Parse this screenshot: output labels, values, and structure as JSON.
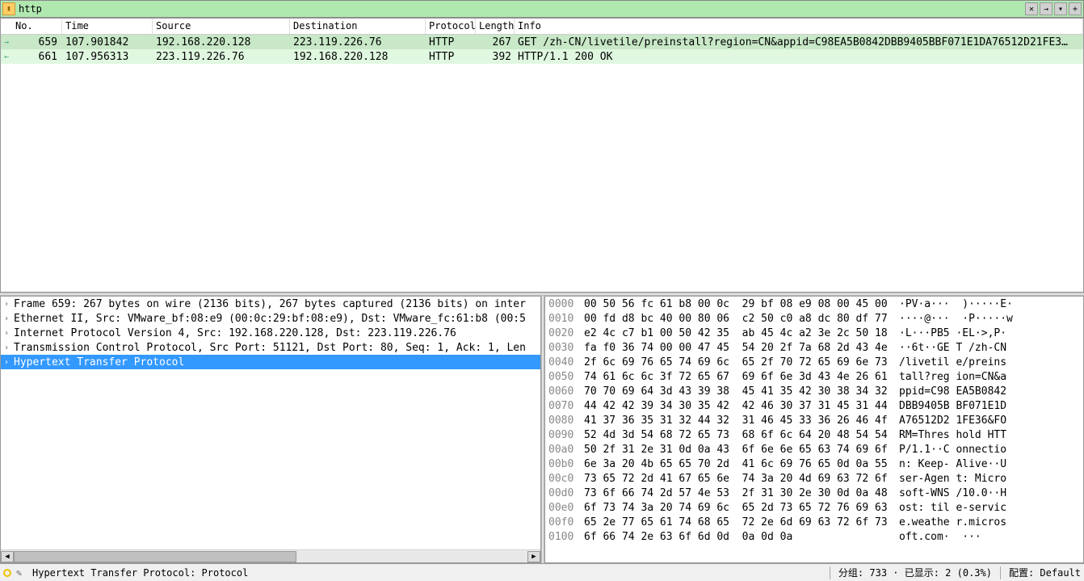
{
  "filter": {
    "value": "http"
  },
  "columns": {
    "no": "No.",
    "time": "Time",
    "source": "Source",
    "destination": "Destination",
    "protocol": "Protocol",
    "length": "Length",
    "info": "Info"
  },
  "packets": [
    {
      "no": "659",
      "time": "107.901842",
      "src": "192.168.220.128",
      "dst": "223.119.226.76",
      "proto": "HTTP",
      "len": "267",
      "info": "GET /zh-CN/livetile/preinstall?region=CN&appid=C98EA5B0842DBB9405BBF071E1DA76512D21FE3…",
      "selected": true,
      "dir": "out"
    },
    {
      "no": "661",
      "time": "107.956313",
      "src": "223.119.226.76",
      "dst": "192.168.220.128",
      "proto": "HTTP",
      "len": "392",
      "info": "HTTP/1.1 200 OK",
      "selected": false,
      "dir": "in"
    }
  ],
  "tree": [
    {
      "label": "Frame 659: 267 bytes on wire (2136 bits), 267 bytes captured (2136 bits) on inter",
      "selected": false
    },
    {
      "label": "Ethernet II, Src: VMware_bf:08:e9 (00:0c:29:bf:08:e9), Dst: VMware_fc:61:b8 (00:5",
      "selected": false
    },
    {
      "label": "Internet Protocol Version 4, Src: 192.168.220.128, Dst: 223.119.226.76",
      "selected": false
    },
    {
      "label": "Transmission Control Protocol, Src Port: 51121, Dst Port: 80, Seq: 1, Ack: 1, Len",
      "selected": false
    },
    {
      "label": "Hypertext Transfer Protocol",
      "selected": true
    }
  ],
  "hex": [
    {
      "off": "0000",
      "b": "00 50 56 fc 61 b8 00 0c  29 bf 08 e9 08 00 45 00",
      "a": "·PV·a···  )·····E·"
    },
    {
      "off": "0010",
      "b": "00 fd d8 bc 40 00 80 06  c2 50 c0 a8 dc 80 df 77",
      "a": "····@···  ·P·····w"
    },
    {
      "off": "0020",
      "b": "e2 4c c7 b1 00 50 42 35  ab 45 4c a2 3e 2c 50 18",
      "a": "·L···PB5 ·EL·>,P·"
    },
    {
      "off": "0030",
      "b": "fa f0 36 74 00 00 47 45  54 20 2f 7a 68 2d 43 4e",
      "a": "··6t··GE T /zh-CN"
    },
    {
      "off": "0040",
      "b": "2f 6c 69 76 65 74 69 6c  65 2f 70 72 65 69 6e 73",
      "a": "/livetil e/preins"
    },
    {
      "off": "0050",
      "b": "74 61 6c 6c 3f 72 65 67  69 6f 6e 3d 43 4e 26 61",
      "a": "tall?reg ion=CN&a"
    },
    {
      "off": "0060",
      "b": "70 70 69 64 3d 43 39 38  45 41 35 42 30 38 34 32",
      "a": "ppid=C98 EA5B0842"
    },
    {
      "off": "0070",
      "b": "44 42 42 39 34 30 35 42  42 46 30 37 31 45 31 44",
      "a": "DBB9405B BF071E1D"
    },
    {
      "off": "0080",
      "b": "41 37 36 35 31 32 44 32  31 46 45 33 36 26 46 4f",
      "a": "A76512D2 1FE36&FO"
    },
    {
      "off": "0090",
      "b": "52 4d 3d 54 68 72 65 73  68 6f 6c 64 20 48 54 54",
      "a": "RM=Thres hold HTT"
    },
    {
      "off": "00a0",
      "b": "50 2f 31 2e 31 0d 0a 43  6f 6e 6e 65 63 74 69 6f",
      "a": "P/1.1··C onnectio"
    },
    {
      "off": "00b0",
      "b": "6e 3a 20 4b 65 65 70 2d  41 6c 69 76 65 0d 0a 55",
      "a": "n: Keep- Alive··U"
    },
    {
      "off": "00c0",
      "b": "73 65 72 2d 41 67 65 6e  74 3a 20 4d 69 63 72 6f",
      "a": "ser-Agen t: Micro"
    },
    {
      "off": "00d0",
      "b": "73 6f 66 74 2d 57 4e 53  2f 31 30 2e 30 0d 0a 48",
      "a": "soft-WNS /10.0··H"
    },
    {
      "off": "00e0",
      "b": "6f 73 74 3a 20 74 69 6c  65 2d 73 65 72 76 69 63",
      "a": "ost: til e-servic"
    },
    {
      "off": "00f0",
      "b": "65 2e 77 65 61 74 68 65  72 2e 6d 69 63 72 6f 73",
      "a": "e.weathe r.micros"
    },
    {
      "off": "0100",
      "b": "6f 66 74 2e 63 6f 6d 0d  0a 0d 0a",
      "a": "oft.com·  ···"
    }
  ],
  "status": {
    "left": "Hypertext Transfer Protocol: Protocol",
    "packets": "分组: 733 · 已显示: 2 (0.3%)",
    "profile": "配置: Default"
  }
}
